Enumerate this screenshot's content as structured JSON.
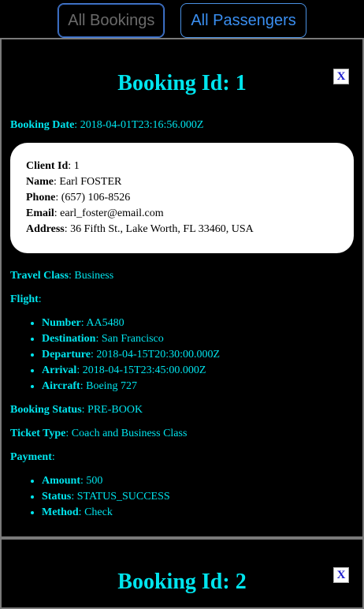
{
  "nav": {
    "all_bookings": "All Bookings",
    "all_passengers": "All Passengers"
  },
  "bookings": [
    {
      "title": "Booking Id: 1",
      "close_label": "X",
      "booking_date_label": "Booking Date",
      "booking_date": "2018-04-01T23:16:56.000Z",
      "client": {
        "id_label": "Client Id",
        "id": "1",
        "name_label": "Name",
        "name": "Earl FOSTER",
        "phone_label": "Phone",
        "phone": "(657) 106-8526",
        "email_label": "Email",
        "email": "earl_foster@email.com",
        "address_label": "Address",
        "address": "36 Fifth St., Lake Worth, FL 33460, USA"
      },
      "travel_class_label": "Travel Class",
      "travel_class": "Business",
      "flight_label": "Flight",
      "flight": [
        {
          "label": "Number",
          "value": "AA5480"
        },
        {
          "label": "Destination",
          "value": "San Francisco"
        },
        {
          "label": "Departure",
          "value": "2018-04-15T20:30:00.000Z"
        },
        {
          "label": "Arrival",
          "value": "2018-04-15T23:45:00.000Z"
        },
        {
          "label": "Aircraft",
          "value": "Boeing 727"
        }
      ],
      "booking_status_label": "Booking Status",
      "booking_status": "PRE-BOOK",
      "ticket_type_label": "Ticket Type",
      "ticket_type": "Coach and Business Class",
      "payment_label": "Payment",
      "payment": [
        {
          "label": "Amount",
          "value": "500"
        },
        {
          "label": "Status",
          "value": "STATUS_SUCCESS"
        },
        {
          "label": "Method",
          "value": "Check"
        }
      ]
    },
    {
      "title": "Booking Id: 2",
      "close_label": "X"
    }
  ]
}
